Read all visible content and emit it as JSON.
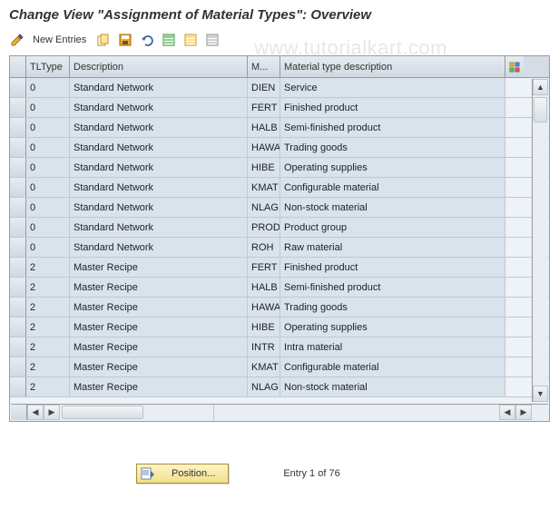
{
  "title": "Change View \"Assignment of Material Types\": Overview",
  "toolbar": {
    "new_entries_label": "New Entries"
  },
  "watermark": "www.tutorialkart.com",
  "grid": {
    "headers": {
      "tltype": "TLType",
      "description": "Description",
      "material": "M...",
      "material_desc": "Material type description"
    },
    "rows": [
      {
        "tl": "0",
        "desc": "Standard Network",
        "mat": "DIEN",
        "matdesc": "Service"
      },
      {
        "tl": "0",
        "desc": "Standard Network",
        "mat": "FERT",
        "matdesc": "Finished product"
      },
      {
        "tl": "0",
        "desc": "Standard Network",
        "mat": "HALB",
        "matdesc": "Semi-finished product"
      },
      {
        "tl": "0",
        "desc": "Standard Network",
        "mat": "HAWA",
        "matdesc": "Trading goods"
      },
      {
        "tl": "0",
        "desc": "Standard Network",
        "mat": "HIBE",
        "matdesc": "Operating supplies"
      },
      {
        "tl": "0",
        "desc": "Standard Network",
        "mat": "KMAT",
        "matdesc": "Configurable material"
      },
      {
        "tl": "0",
        "desc": "Standard Network",
        "mat": "NLAG",
        "matdesc": "Non-stock material"
      },
      {
        "tl": "0",
        "desc": "Standard Network",
        "mat": "PROD",
        "matdesc": "Product group"
      },
      {
        "tl": "0",
        "desc": "Standard Network",
        "mat": "ROH",
        "matdesc": "Raw material"
      },
      {
        "tl": "2",
        "desc": "Master Recipe",
        "mat": "FERT",
        "matdesc": "Finished product"
      },
      {
        "tl": "2",
        "desc": "Master Recipe",
        "mat": "HALB",
        "matdesc": "Semi-finished product"
      },
      {
        "tl": "2",
        "desc": "Master Recipe",
        "mat": "HAWA",
        "matdesc": "Trading goods"
      },
      {
        "tl": "2",
        "desc": "Master Recipe",
        "mat": "HIBE",
        "matdesc": "Operating supplies"
      },
      {
        "tl": "2",
        "desc": "Master Recipe",
        "mat": "INTR",
        "matdesc": "Intra material"
      },
      {
        "tl": "2",
        "desc": "Master Recipe",
        "mat": "KMAT",
        "matdesc": "Configurable material"
      },
      {
        "tl": "2",
        "desc": "Master Recipe",
        "mat": "NLAG",
        "matdesc": "Non-stock material"
      }
    ]
  },
  "footer": {
    "position_label": "Position...",
    "entry_label": "Entry 1 of 76"
  }
}
